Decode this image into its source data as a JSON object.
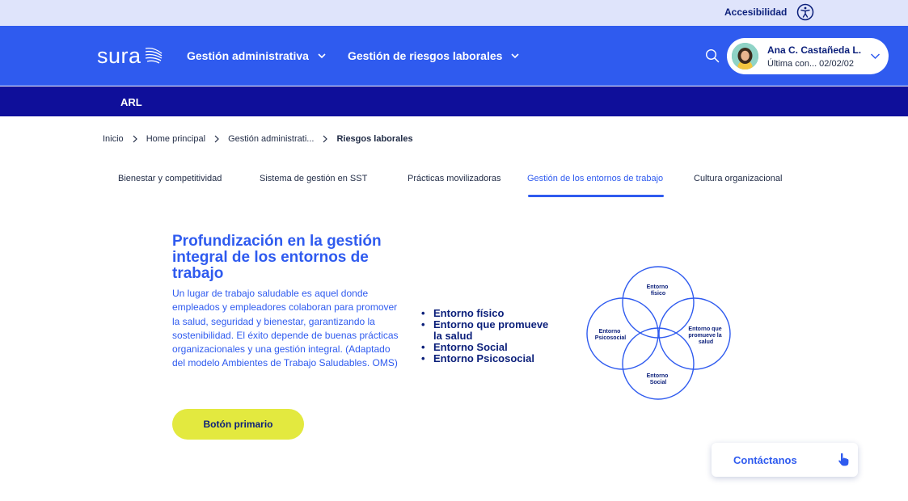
{
  "topbar": {
    "accessibility_label": "Accesibilidad",
    "icon": "accessibility-icon"
  },
  "header": {
    "logo_text": "sura",
    "nav": [
      {
        "label": "Gestión administrativa"
      },
      {
        "label": "Gestión de riesgos laborales"
      }
    ],
    "user": {
      "name": "Ana C. Castañeda L.",
      "last_access": "Última con... 02/02/02"
    }
  },
  "subbar": {
    "label": "ARL"
  },
  "breadcrumb": [
    {
      "label": "Inicio"
    },
    {
      "label": "Home principal"
    },
    {
      "label": "Gestión administrati..."
    },
    {
      "label": "Riesgos laborales"
    }
  ],
  "tabs": [
    {
      "label": "Bienestar y competitividad"
    },
    {
      "label": "Sistema de gestión en SST"
    },
    {
      "label": "Prácticas movilizadoras"
    },
    {
      "label": "Gestión de los entornos de trabajo",
      "active": true
    },
    {
      "label": "Cultura organizacional"
    }
  ],
  "content": {
    "title": "Profundización en la gestión integral de los entornos de trabajo",
    "description": "Un lugar de trabajo saludable es aquel donde empleados y empleadores colaboran para promover la salud, seguridad y bienestar, garantizando la sostenibilidad. El éxito depende de buenas prácticas organizacionales y una gestión integral. (Adaptado del modelo Ambientes de Trabajo Saludables. OMS)",
    "primary_button": "Botón primario",
    "bullets": [
      "Entorno físico",
      "Entorno que promueve la salud",
      "Entorno Social",
      "Entorno Psicosocial"
    ]
  },
  "diagram": {
    "top": [
      "Entorno",
      "físico"
    ],
    "left": [
      "Entorno",
      "Psicosocial"
    ],
    "right": [
      "Entorno que",
      "promueve la",
      "salud"
    ],
    "bottom": [
      "Entorno",
      "Social"
    ]
  },
  "contact": {
    "label": "Contáctanos"
  },
  "colors": {
    "primary": "#2f5bef",
    "navy": "#0f0f9a",
    "accent": "#e3e93f",
    "topbar": "#dfe4fb"
  }
}
